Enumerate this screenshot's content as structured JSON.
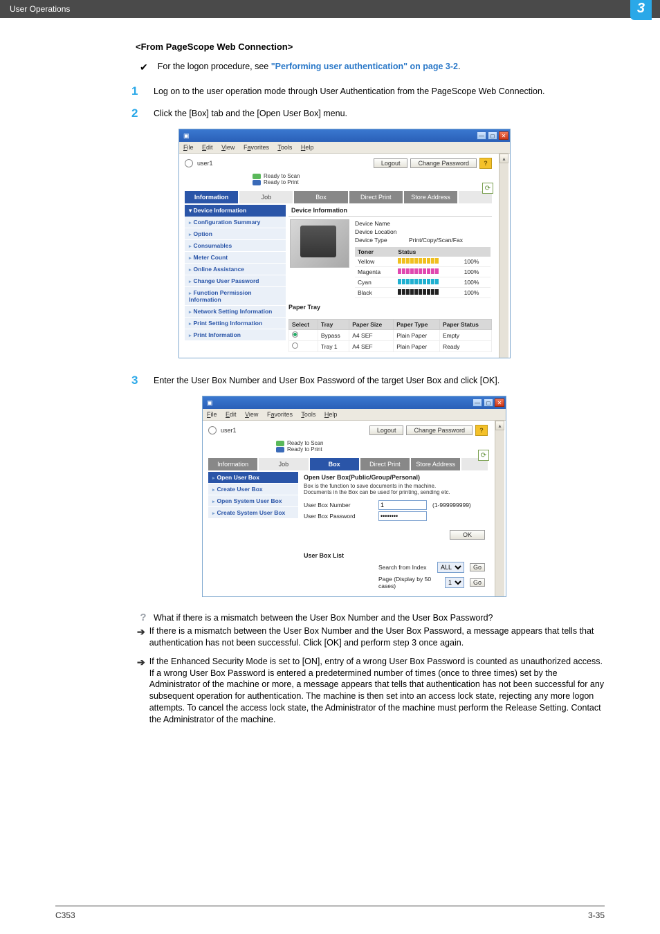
{
  "header": {
    "breadcrumb": "User Operations",
    "chapter": "3"
  },
  "section_title": "<From PageScope Web Connection>",
  "note": {
    "prefix": "For the logon procedure, see ",
    "link": "\"Performing user authentication\" on page 3-2",
    "suffix": "."
  },
  "steps": [
    {
      "n": "1",
      "text": "Log on to the user operation mode through User Authentication from the PageScope Web Connection."
    },
    {
      "n": "2",
      "text": "Click the [Box] tab and the [Open User Box] menu."
    },
    {
      "n": "3",
      "text": "Enter the User Box Number and User Box Password of the target User Box and click [OK]."
    }
  ],
  "browser_menu": [
    "File",
    "Edit",
    "View",
    "Favorites",
    "Tools",
    "Help"
  ],
  "mock1": {
    "user": "user1",
    "logout": "Logout",
    "change_pw": "Change Password",
    "status1": "Ready to Scan",
    "status2": "Ready to Print",
    "tabs": [
      "Information",
      "Job",
      "Box",
      "Direct Print",
      "Store Address"
    ],
    "side_header": "Device Information",
    "side_items": [
      "Configuration Summary",
      "Option",
      "Consumables",
      "Meter Count",
      "Online Assistance",
      "Change User Password",
      "Function Permission Information",
      "Network Setting Information",
      "Print Setting Information",
      "Print Information"
    ],
    "main_header": "Device Information",
    "dev": {
      "name_label": "Device Name",
      "loc_label": "Device Location",
      "type_label": "Device Type",
      "type_val": "Print/Copy/Scan/Fax"
    },
    "toner_header_a": "Toner",
    "toner_header_b": "Status",
    "toners": [
      {
        "name": "Yellow",
        "pct": "100%",
        "cls": "y"
      },
      {
        "name": "Magenta",
        "pct": "100%",
        "cls": "m"
      },
      {
        "name": "Cyan",
        "pct": "100%",
        "cls": "c"
      },
      {
        "name": "Black",
        "pct": "100%",
        "cls": "k"
      }
    ],
    "tray_caption": "Paper Tray",
    "tray_headers": [
      "Select",
      "Tray",
      "Paper Size",
      "Paper Type",
      "Paper Status"
    ],
    "trays": [
      {
        "sel": true,
        "tray": "Bypass",
        "size": "A4 SEF",
        "type": "Plain Paper",
        "status": "Empty"
      },
      {
        "sel": false,
        "tray": "Tray 1",
        "size": "A4 SEF",
        "type": "Plain Paper",
        "status": "Ready"
      }
    ]
  },
  "mock2": {
    "tabs": [
      "Information",
      "Job",
      "Box",
      "Direct Print",
      "Store Address"
    ],
    "side_items": [
      "Open User Box",
      "Create User Box",
      "Open System User Box",
      "Create System User Box"
    ],
    "main_header": "Open User Box(Public/Group/Personal)",
    "desc1": "Box is the function to save documents in the machine.",
    "desc2": "Documents in the Box can be used for printing, sending etc.",
    "num_label": "User Box Number",
    "num_val": "1",
    "num_range": "(1-999999999)",
    "pw_label": "User Box Password",
    "pw_val": "••••••••",
    "ok": "OK",
    "list_header": "User Box List",
    "search_label": "Search from Index",
    "search_sel": "ALL",
    "go": "Go",
    "page_label": "Page (Display by 50 cases)",
    "page_sel": "1"
  },
  "qa": {
    "q": "What if there is a mismatch between the User Box Number and the User Box Password?",
    "a1": "If there is a mismatch between the User Box Number and the User Box Password, a message appears that tells that authentication has not been successful. Click [OK] and perform step 3 once again.",
    "a2": "If the Enhanced Security Mode is set to [ON], entry of a wrong User Box Password is counted as unauthorized access. If a wrong User Box Password is entered a predetermined number of times (once to three times) set by the Administrator of the machine or more, a message appears that tells that authentication has not been successful for any subsequent operation for authentication. The machine is then set into an access lock state, rejecting any more logon attempts. To cancel the access lock state, the Administrator of the machine must perform the Release Setting. Contact the Administrator of the machine."
  },
  "footer": {
    "left": "C353",
    "right": "3-35"
  }
}
